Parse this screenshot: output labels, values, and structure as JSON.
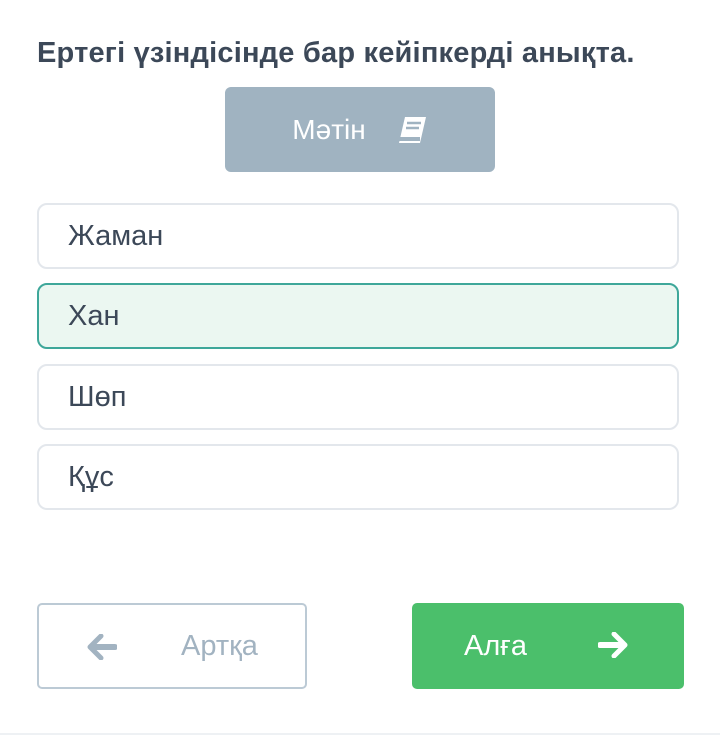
{
  "question": {
    "text": "Ертегі үзіндісінде бар кейіпкерді анықта."
  },
  "text_button": {
    "label": "Мәтін",
    "icon": "book-icon",
    "color": "#a0b3c1"
  },
  "options": [
    {
      "label": "Жаман",
      "selected": false
    },
    {
      "label": "Хан",
      "selected": true
    },
    {
      "label": "Шөп",
      "selected": false
    },
    {
      "label": "Құс",
      "selected": false
    }
  ],
  "navigation": {
    "back_label": "Артқа",
    "back_icon": "arrow-left-icon",
    "next_label": "Алға",
    "next_icon": "arrow-right-icon",
    "next_color": "#4bbf6b"
  },
  "colors": {
    "selected_border": "#3ea79a",
    "selected_background": "#ebf7f1",
    "text": "#3c4858"
  }
}
